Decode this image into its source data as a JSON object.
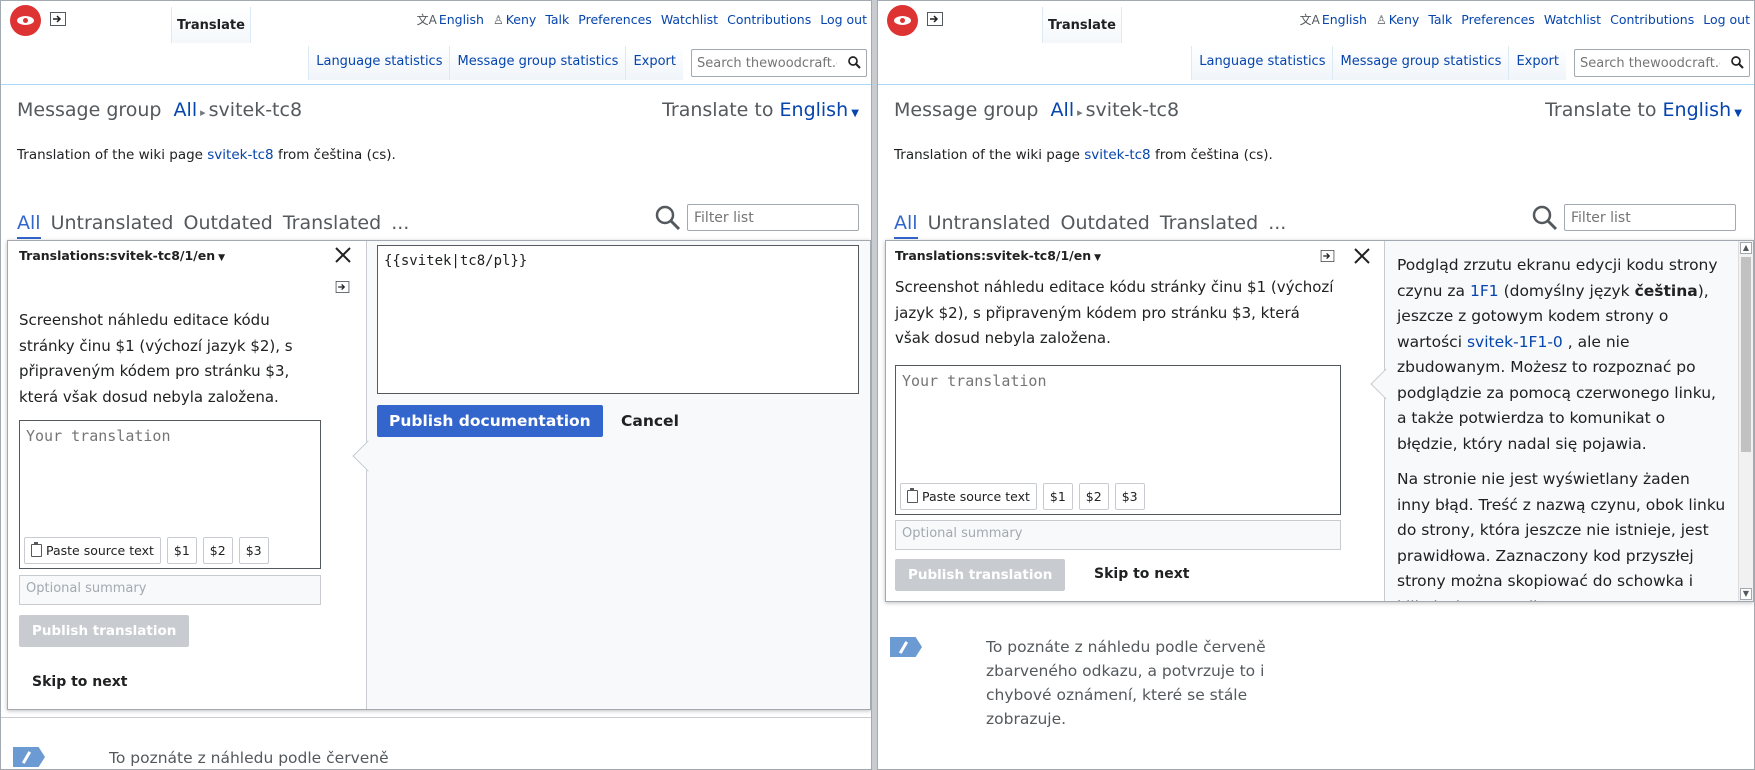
{
  "header": {
    "tab_translate": "Translate",
    "personal": {
      "language": "English",
      "user": "Keny",
      "talk": "Talk",
      "preferences": "Preferences",
      "watchlist": "Watchlist",
      "contributions": "Contributions",
      "logout": "Log out"
    },
    "actions": {
      "language_statistics": "Language statistics",
      "message_group_statistics": "Message group statistics",
      "export": "Export"
    },
    "search_placeholder": "Search thewoodcraft.org"
  },
  "main": {
    "message_group_label": "Message group",
    "message_group_all": "All",
    "message_group_name": "svitek-tc8",
    "translate_to_label": "Translate to",
    "translate_to_lang": "English",
    "desc_prefix": "Translation of the wiki page",
    "desc_link": "svitek-tc8",
    "desc_suffix": "from čeština (cs).",
    "filter_tabs": [
      "All",
      "Untranslated",
      "Outdated",
      "Translated",
      "..."
    ],
    "filter_placeholder": "Filter list"
  },
  "editor": {
    "title": "Translations:svitek-tc8/1/en",
    "source_text": "Screenshot náhledu editace kódu stránky činu $1 (výchozí jazyk $2), s připraveným kódem pro stránku $3, která však dosud nebyla založena.",
    "translation_placeholder": "Your translation",
    "paste_source": "Paste source text",
    "insertables": [
      "$1",
      "$2",
      "$3"
    ],
    "summary_placeholder": "Optional summary",
    "publish_translation": "Publish translation",
    "skip_to_next": "Skip to next"
  },
  "doc_editor": {
    "value": "{{svitek|tc8/pl}}",
    "publish_documentation": "Publish documentation",
    "cancel": "Cancel"
  },
  "help": {
    "p1_a": "Podgląd zrzutu ekranu edycji kodu strony czynu za",
    "p1_link1": "1F1",
    "p1_b": "(domyślny język",
    "p1_bold": "čeština",
    "p1_c": "), jeszcze z gotowym kodem strony o wartości",
    "p1_link2": "svitek-1F1-0",
    "p1_d": ", ale nie zbudowanym. Możesz to rozpoznać po podglądzie za pomocą czerwonego linku, a także potwierdza to komunikat o błędzie, który nadal się pojawia.",
    "p2": "Na stronie nie jest wyświetlany żaden inny błąd. Treść z nazwą czynu, obok linku do strony, która jeszcze nie istnieje, jest prawidłowa. Zaznaczony kod przyszłej strony można skopiować do schowka i kliknięciem na odkaz. Z"
  },
  "below": {
    "text_right": "To poznáte z náhledu podle červeně zbarveného odkazu, a potvrzuje to i chybové oznámení, které se stále zobrazuje.",
    "text_left": "To poznáte z náhledu podle červeně"
  },
  "colors": {
    "link": "#0645ad",
    "primary_button": "#3366cc",
    "disabled_button": "#c8ccd1"
  }
}
